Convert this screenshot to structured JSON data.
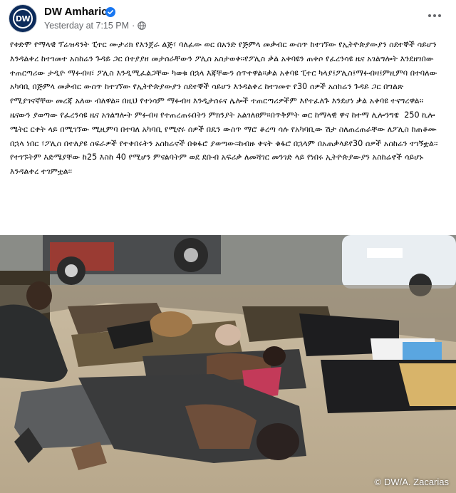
{
  "header": {
    "page_name": "DW Amharic",
    "avatar_text": "DW",
    "timestamp": "Yesterday at 7:15 PM",
    "separator": "·",
    "verified_icon": "verified-badge-icon",
    "audience_icon": "globe-icon",
    "more_icon": "more-options-icon"
  },
  "post": {
    "text": "የቀድሞ የማላዊ ፕሬዝዳንት ፒተር ሙታሪክ የእንጀራ ልጅ፣ ባለፈው ወር በአንድ የጅምላ መቃብር ውስጥ ከተገኘው የኢትዮጵያውያን ስደተኞች ሳይሆን እንዳልቀረ ከተገመተ አስከሬን ጉዳይ ጋር በተያያዘ መታሰራቸውን ፖሊስ አስታወቀ፡፡የፖሊስ ቃል አቀባዩን ጠቀሶ የፈረንሳዩ ዜና አገልግሎት እንደዘገበው ተጠርጣሪው ታዲዮ ማፉብዛ፣ ፖሊስ እንዲሚፈልጋቸው ካወቁ በኋላ እጃቸውን ሰጥተዋል፡፡ቃል አቀባዩ ፒተር ካላያ፤ፖሊስ፤ማፉብዛ፤ምዚምባ በተባለው አካባቢ በጅምላ መቃብር ውስጥ ከተገኘው የኢትዮጵያውያን ስደተኞች ሳይሆን እንዳልቀረ ከተገመተ የ30 ሰዎች አስከሬን ጉዳይ ጋር በግልጽ የሚያገናኛቸው መረጃ አለው ብለዋል፡፡ በዚህ የተነሳም ማፉብዛ እንዲታሰሩና ሌሎች ተጠርጣሪዎችም እየተፈለጉ እንደሆነ ቃል አቀባዩ ተናግረዋል፡፡ ዜናውን ያወጣው የፈረንሳዩ ዜና አገልግሎት ምፉብዛ የተጠረጠሩበትን ምክንያት አልገለፀም፡፡በጥቅምት ወር ከማላዊ ዋና ከተማ ሊሎንግዌ  250 ኪሎ ሜትር ርቀት ላይ በሚገኘው ሚዚምባ በተባለ አካባቢ የሚኖሩ ሰዎች በዴን ውስጥ ማሮ ቆረጣ ሳሉ የአካባቢው ሽታ ስለጠረጠራቸው ለፖሊስ ከጠቆሙ በኋላ ነበር ፣ፖሊስ በተለያዩ ስፍራዎች የተቀበሩትን አስከሬኖች በቁፋሮ ያወጣው፡፡ከብዙ ቀናት ቁፋሮ በኋላም በአጠቃላይየ30 ሰዎች አስከሬን ተገኝቷል፡፡የተገኙትም እድሜያቸው ከ25 እስከ 40 የሚሆን ምናልባትም ወደ ደቡብ አፍሪቃ ለመሻገር መንገድ ላይ የነበሩ ኢትዮጵያውያን አስከሬኖች ሳይሆኑ እንዳልቀረ ተገምቷል፡፡"
  },
  "photo": {
    "credit": "DW/A. Zacarias",
    "credit_symbol": "©"
  },
  "colors": {
    "brand": "#0c2b5b",
    "verified": "#1877f2",
    "meta_text": "#65676b"
  }
}
